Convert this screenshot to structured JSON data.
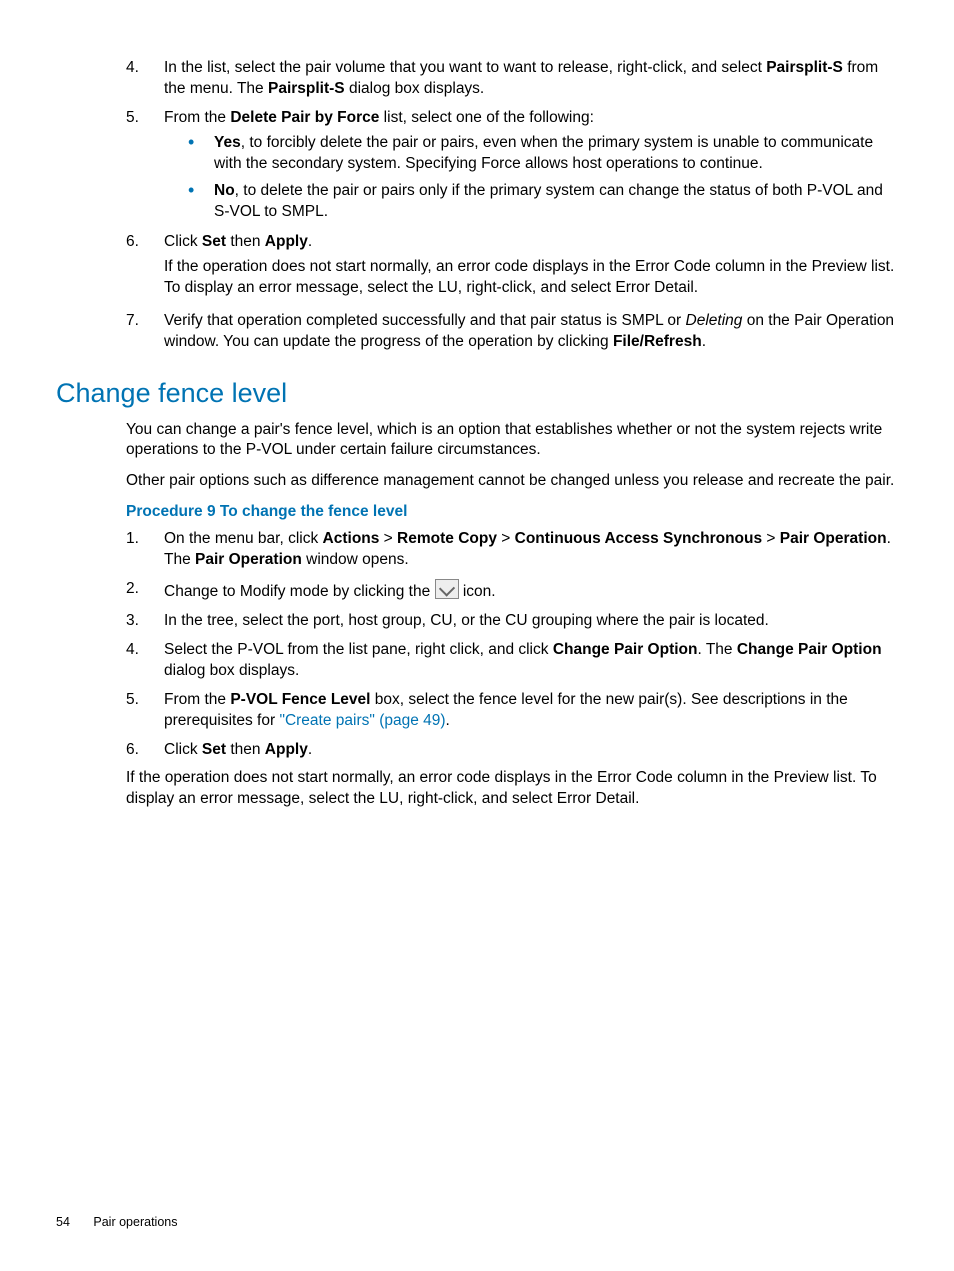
{
  "list1": {
    "item4": {
      "num": "4.",
      "text_a": "In the list, select the pair volume that you want to want to release, right-click, and select ",
      "b1": "Pairsplit-S",
      "text_b": " from the menu. The ",
      "b2": "Pairsplit-S",
      "text_c": " dialog box displays."
    },
    "item5": {
      "num": "5.",
      "text_a": "From the ",
      "b1": "Delete Pair by Force",
      "text_b": " list, select one of the following:",
      "yes": {
        "b": "Yes",
        "text": ", to forcibly delete the pair or pairs, even when the primary system is unable to communicate with the secondary system. Specifying Force allows host operations to continue."
      },
      "no": {
        "b": "No",
        "text": ", to delete the pair or pairs only if the primary system can change the status of both P-VOL and S-VOL to SMPL."
      }
    },
    "item6": {
      "num": "6.",
      "text_a": "Click ",
      "b1": "Set",
      "text_b": " then ",
      "b2": "Apply",
      "text_c": ".",
      "p2": "If the operation does not start normally, an error code displays in the Error Code column in the Preview list. To display an error message, select the LU, right-click, and select Error Detail."
    },
    "item7": {
      "num": "7.",
      "text_a": "Verify that operation completed successfully and that pair status is SMPL or ",
      "i1": "Deleting",
      "text_b": " on the Pair Operation window. You can update the progress of the operation by clicking ",
      "b1": "File/Refresh",
      "text_c": "."
    }
  },
  "section": {
    "title": "Change fence level",
    "intro1": "You can change a pair's fence level, which is an option that establishes whether or not the system rejects write operations to the P-VOL under certain failure circumstances.",
    "intro2": "Other pair options such as difference management cannot be changed unless you release and recreate the pair.",
    "procTitle": "Procedure 9 To change the fence level"
  },
  "list2": {
    "item1": {
      "num": "1.",
      "text_a": "On the menu bar, click ",
      "b1": "Actions",
      "gt1": " > ",
      "b2": "Remote Copy",
      "gt2": " > ",
      "b3": "Continuous Access Synchronous",
      "gt3": " > ",
      "b4": "Pair Operation",
      "text_b": ". The ",
      "b5": "Pair Operation",
      "text_c": " window opens."
    },
    "item2": {
      "num": "2.",
      "text_a": "Change to Modify mode by clicking the ",
      "text_b": " icon."
    },
    "item3": {
      "num": "3.",
      "text": "In the tree, select the port, host group, CU, or the CU grouping where the pair is located."
    },
    "item4": {
      "num": "4.",
      "text_a": "Select the P-VOL from the list pane, right click, and click ",
      "b1": "Change Pair Option",
      "text_b": ". The ",
      "b2": "Change Pair Option",
      "text_c": " dialog box displays."
    },
    "item5": {
      "num": "5.",
      "text_a": "From the ",
      "b1": "P-VOL Fence Level",
      "text_b": " box, select the fence level for the new pair(s). See descriptions in the prerequisites for ",
      "link": "\"Create pairs\" (page 49)",
      "text_c": "."
    },
    "item6": {
      "num": "6.",
      "text_a": "Click ",
      "b1": "Set",
      "text_b": " then ",
      "b2": "Apply",
      "text_c": "."
    }
  },
  "closing": "If the operation does not start normally, an error code displays in the Error Code column in the Preview list. To display an error message, select the LU, right-click, and select Error Detail.",
  "footer": {
    "page": "54",
    "chapter": "Pair operations"
  }
}
